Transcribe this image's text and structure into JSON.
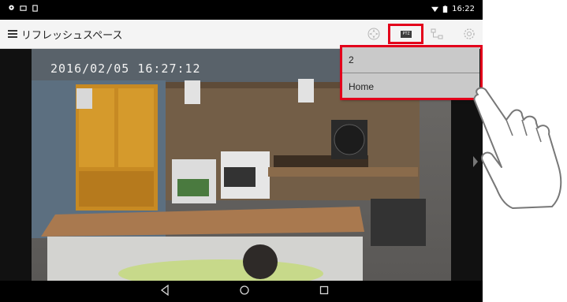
{
  "statusbar": {
    "time": "16:22"
  },
  "appbar": {
    "title": "リフレッシュスペース"
  },
  "toolbar": {
    "preset_chip": "PTZ"
  },
  "video": {
    "timestamp": "2016/02/05  16:27:12"
  },
  "preset_menu": {
    "items": [
      "2",
      "Home"
    ]
  },
  "colors": {
    "highlight": "#e3001b",
    "menu_bg": "#c9c9c9",
    "appbar_bg": "#f4f4f4"
  }
}
